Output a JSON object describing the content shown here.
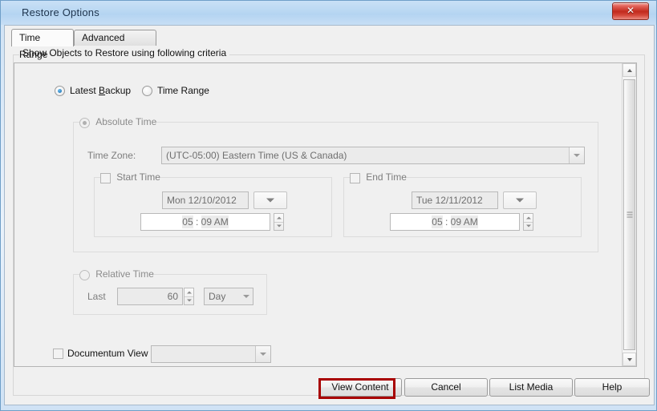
{
  "window": {
    "title": "Restore Options",
    "close_label": "✕",
    "close_icon": "close-icon"
  },
  "tabs": [
    {
      "label": "Time Range",
      "active": true
    },
    {
      "label": "Advanced Options",
      "active": false
    }
  ],
  "group": {
    "legend": "Show Objects to Restore using following criteria"
  },
  "mode_radios": [
    {
      "label_pre": "Latest ",
      "label_key": "B",
      "label_post": "ackup",
      "label": "Latest Backup",
      "checked": true
    },
    {
      "label": "Time Range",
      "checked": false
    }
  ],
  "absolute_time": {
    "legend": "Absolute Time",
    "radio_checked": true,
    "enabled": false,
    "time_zone": {
      "label": "Time Zone:",
      "value": "(UTC-05:00) Eastern Time (US & Canada)"
    },
    "start_time": {
      "legend": "Start Time",
      "checked": false,
      "date": "Mon 12/10/2012",
      "time_hour": "05",
      "time_sep": ":",
      "time_minute": "09 AM",
      "time_display": "05 : 09 AM"
    },
    "end_time": {
      "legend": "End Time",
      "checked": false,
      "date": "Tue 12/11/2012",
      "time_hour": "05",
      "time_sep": ":",
      "time_minute": "09 AM",
      "time_display": "05 : 09 AM"
    }
  },
  "relative_time": {
    "legend": "Relative Time",
    "radio_checked": false,
    "last_label": "Last",
    "last_value": "60",
    "unit_value": "Day"
  },
  "documentum": {
    "label": "Documentum View",
    "checked": false,
    "value": ""
  },
  "buttons": [
    {
      "label": "View Content",
      "highlighted": true
    },
    {
      "label": "Cancel",
      "highlighted": false
    },
    {
      "label": "List Media",
      "highlighted": false
    },
    {
      "label": "Help",
      "highlighted": false
    }
  ],
  "scrollbar": {
    "up_icon": "scroll-up-arrow-icon",
    "down_icon": "scroll-down-arrow-icon"
  },
  "colors": {
    "titlebar": "#b9d7f2",
    "close_red": "#c22a1d",
    "annotation_red": "#a80000",
    "panel_bg": "#f0f0f0",
    "accent_radio": "#1466a8"
  }
}
